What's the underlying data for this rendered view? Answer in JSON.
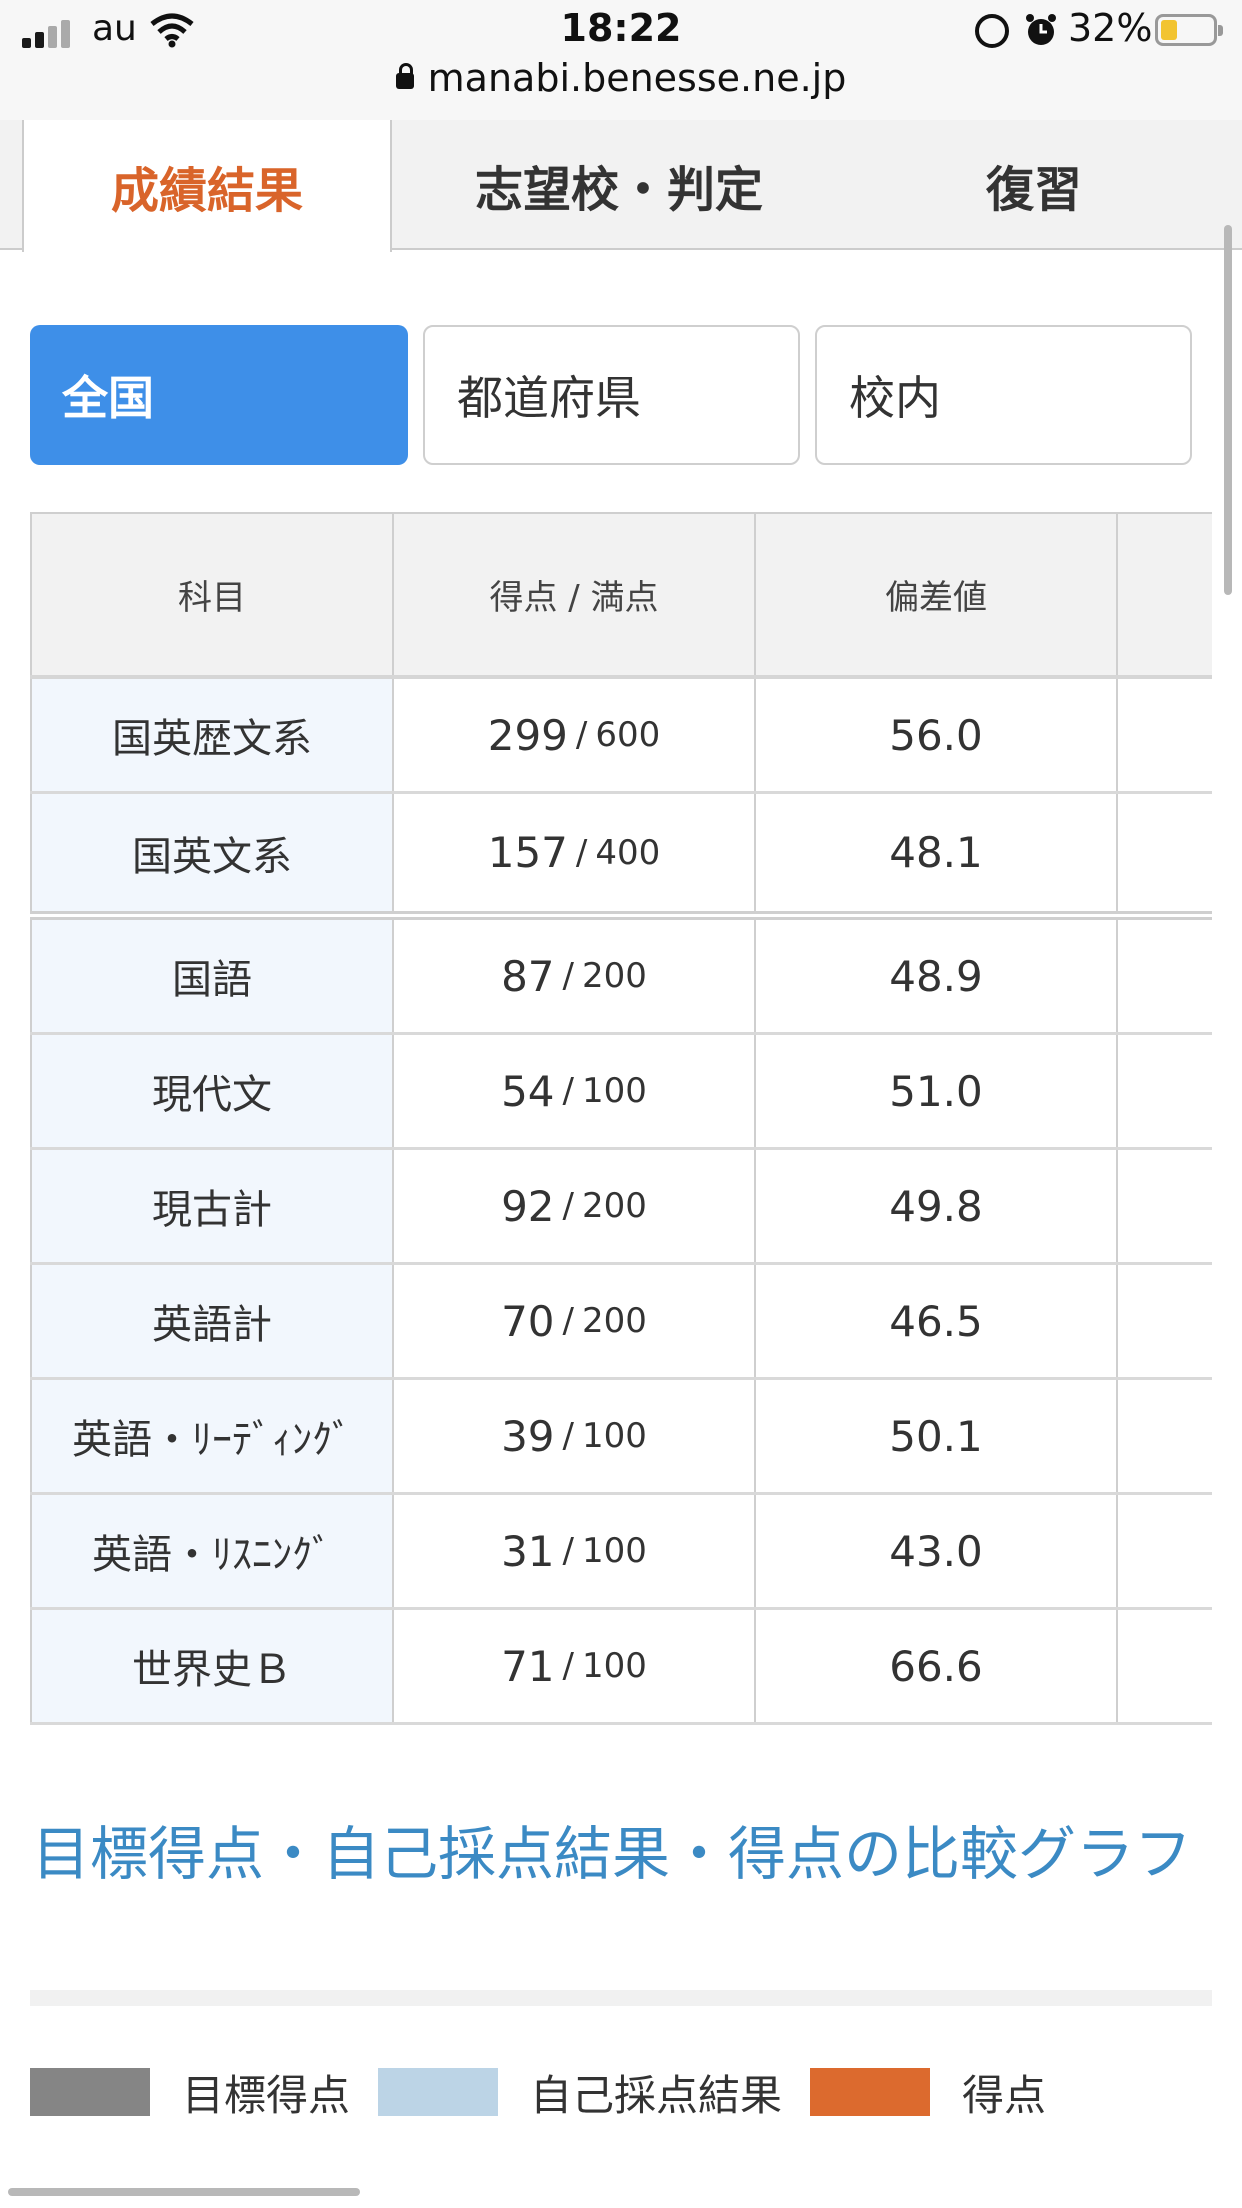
{
  "status_bar": {
    "carrier": "au",
    "time": "18:22",
    "battery_percent": "32%",
    "battery_level": 0.32,
    "url": "manabi.benesse.ne.jp"
  },
  "tabs": [
    {
      "label": "成績結果",
      "active": true
    },
    {
      "label": "志望校・判定",
      "active": false
    },
    {
      "label": "復習",
      "active": false
    }
  ],
  "scope_buttons": [
    {
      "label": "全国",
      "active": true
    },
    {
      "label": "都道府県",
      "active": false
    },
    {
      "label": "校内",
      "active": false
    }
  ],
  "table": {
    "headers": [
      "科目",
      "得点 / 満点",
      "偏差値",
      ""
    ],
    "rows": [
      {
        "subject": "国英歴文系",
        "score": "299",
        "max": "600",
        "deviation": "56.0"
      },
      {
        "subject": "国英文系",
        "score": "157",
        "max": "400",
        "deviation": "48.1"
      },
      {
        "subject": "国語",
        "score": "87",
        "max": "200",
        "deviation": "48.9"
      },
      {
        "subject": "現代文",
        "score": "54",
        "max": "100",
        "deviation": "51.0"
      },
      {
        "subject": "現古計",
        "score": "92",
        "max": "200",
        "deviation": "49.8"
      },
      {
        "subject": "英語計",
        "score": "70",
        "max": "200",
        "deviation": "46.5"
      },
      {
        "subject": "英語・ﾘｰﾃﾞｨﾝｸﾞ",
        "score": "39",
        "max": "100",
        "deviation": "50.1"
      },
      {
        "subject": "英語・ﾘｽﾆﾝｸﾞ",
        "score": "31",
        "max": "100",
        "deviation": "43.0"
      },
      {
        "subject": "世界史Ｂ",
        "score": "71",
        "max": "100",
        "deviation": "66.6"
      }
    ]
  },
  "comparison": {
    "title": "目標得点・自己採点結果・得点の比較グラフ",
    "legend": [
      {
        "label": "目標得点",
        "color": "#858585"
      },
      {
        "label": "自己採点結果",
        "color": "#bcd4e6"
      },
      {
        "label": "得点",
        "color": "#dc6a2e"
      }
    ]
  },
  "colors": {
    "active_tab_text": "#d9642a",
    "active_scope_bg": "#3e8fe8",
    "section_title": "#3b8ac4"
  }
}
